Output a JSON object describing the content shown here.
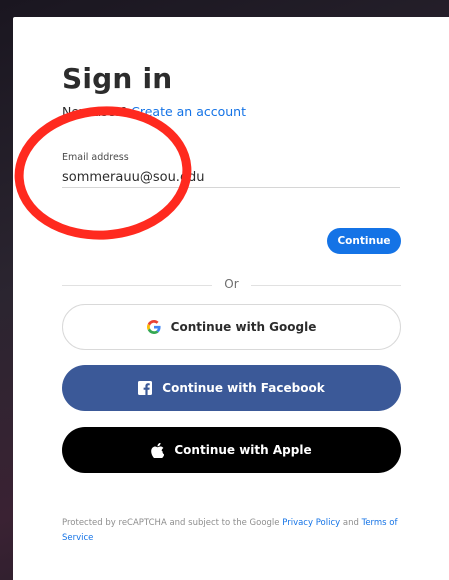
{
  "signin": {
    "title": "Sign in",
    "new_user_prefix": "New user?",
    "create_account_link": "Create an account",
    "email_label": "Email address",
    "email_value": "sommerauu@sou.edu",
    "continue_label": "Continue",
    "or_label": "Or",
    "google_label": "Continue with Google",
    "facebook_label": "Continue with Facebook",
    "apple_label": "Continue with Apple"
  },
  "footer": {
    "text_prefix": "Protected by reCAPTCHA and subject to the Google",
    "privacy_link": "Privacy Policy",
    "and_text": "and",
    "terms_link": "Terms of Service"
  },
  "icons": {
    "google": "google-logo-icon",
    "facebook": "facebook-logo-icon",
    "apple": "apple-logo-icon"
  },
  "colors": {
    "accent": "#1473e6",
    "facebook": "#3b5998",
    "apple": "#000000",
    "annotation": "#ff2a1f"
  }
}
